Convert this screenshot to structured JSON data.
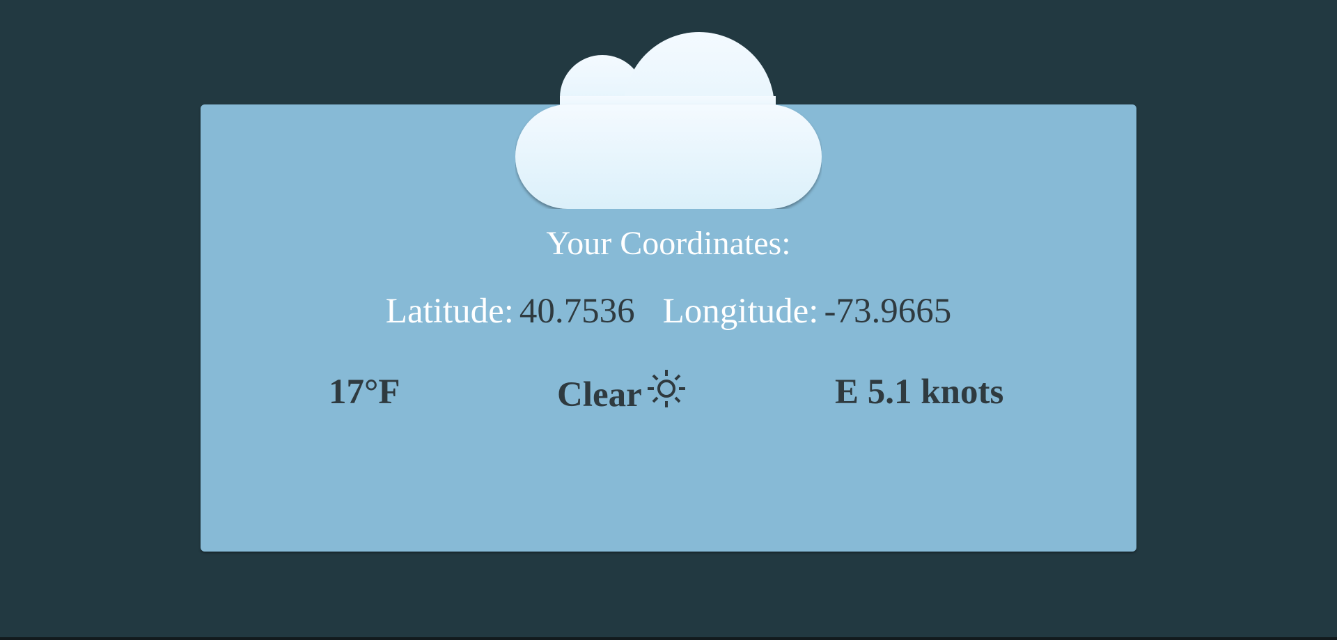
{
  "heading": "Your Coordinates:",
  "coordinates": {
    "latitude_label": "Latitude:",
    "latitude_value": "40.7536",
    "longitude_label": "Longitude:",
    "longitude_value": "-73.9665"
  },
  "weather": {
    "temperature": "17°F",
    "condition": "Clear",
    "condition_icon": "sun-icon",
    "wind": "E 5.1 knots"
  },
  "colors": {
    "background": "#223941",
    "panel": "#87bad6",
    "label_text": "#ffffff",
    "value_text": "#2f3a3f",
    "cloud_top": "#f0f8ff",
    "cloud_bottom": "#dbf0fa"
  }
}
